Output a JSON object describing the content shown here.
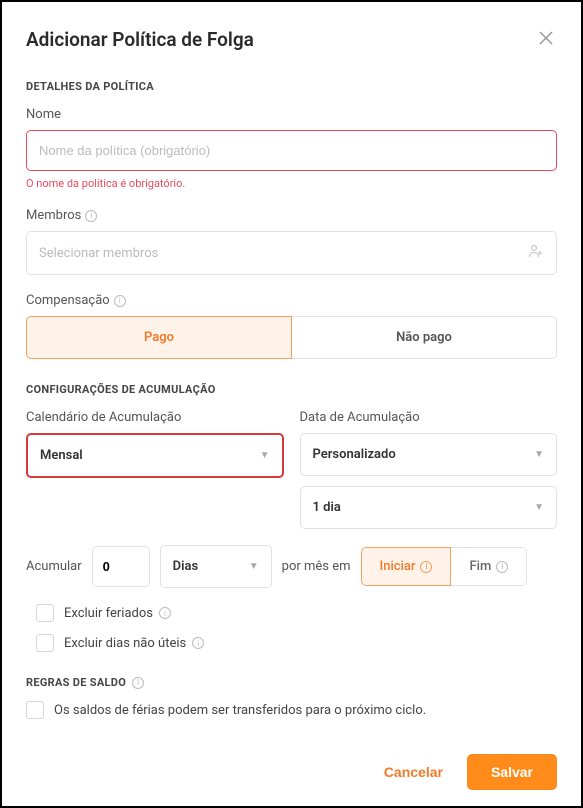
{
  "header": {
    "title": "Adicionar Política de Folga"
  },
  "sections": {
    "policy_details": "DETALHES DA POLÍTICA",
    "accrual_config": "CONFIGURAÇÕES DE ACUMULAÇÃO",
    "balance_rules": "REGRAS DE SALDO"
  },
  "name_field": {
    "label": "Nome",
    "placeholder": "Nome da política (obrigatório)",
    "value": "",
    "error": "O nome da política é obrigatório."
  },
  "members_field": {
    "label": "Membros",
    "placeholder": "Selecionar membros"
  },
  "compensation": {
    "label": "Compensação",
    "paid": "Pago",
    "unpaid": "Não pago"
  },
  "accrual_schedule": {
    "label": "Calendário de Acumulação",
    "value": "Mensal"
  },
  "accrual_date": {
    "label": "Data de Acumulação",
    "value": "Personalizado",
    "day_value": "1 dia"
  },
  "accrue": {
    "label": "Acumular",
    "amount": "0",
    "unit": "Dias",
    "per_month_text": "por mês em",
    "start": "Iniciar",
    "end": "Fim"
  },
  "exclusions": {
    "holidays": "Excluir feriados",
    "non_working": "Excluir dias não úteis"
  },
  "balance": {
    "carryforward": "Os saldos de férias podem ser transferidos para o próximo ciclo."
  },
  "footer": {
    "cancel": "Cancelar",
    "save": "Salvar"
  }
}
